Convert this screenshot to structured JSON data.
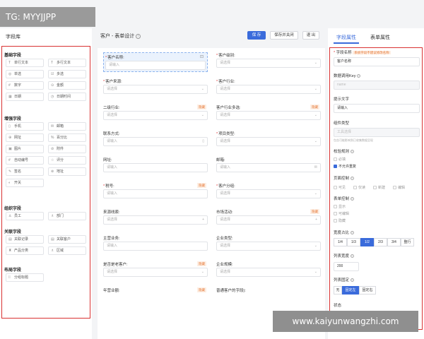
{
  "watermark": "TG: MYYJJPP",
  "url_watermark": "www.kaiyunwangzhi.com",
  "left": {
    "title": "字段库",
    "groups": [
      {
        "name": "基础字段",
        "fields": [
          {
            "icon": "T",
            "label": "单行文本"
          },
          {
            "icon": "T",
            "label": "多行文本"
          },
          {
            "icon": "◎",
            "label": "单选"
          },
          {
            "icon": "☑",
            "label": "多选"
          },
          {
            "icon": "#",
            "label": "数字"
          },
          {
            "icon": "⊙",
            "label": "金额"
          },
          {
            "icon": "▦",
            "label": "日期"
          },
          {
            "icon": "◷",
            "label": "日期时间"
          }
        ]
      },
      {
        "name": "增强字段",
        "fields": [
          {
            "icon": "▯",
            "label": "手机"
          },
          {
            "icon": "✉",
            "label": "邮箱"
          },
          {
            "icon": "⊕",
            "label": "网址"
          },
          {
            "icon": "%",
            "label": "百分比"
          },
          {
            "icon": "▣",
            "label": "图片"
          },
          {
            "icon": "⊘",
            "label": "附件"
          },
          {
            "icon": "#",
            "label": "自动编号"
          },
          {
            "icon": "☆",
            "label": "评分"
          },
          {
            "icon": "✎",
            "label": "签名"
          },
          {
            "icon": "⊚",
            "label": "地址"
          },
          {
            "icon": "◐",
            "label": "开关"
          }
        ]
      },
      {
        "name": "组织字段",
        "fields": [
          {
            "icon": "♙",
            "label": "员工"
          },
          {
            "icon": "♗",
            "label": "部门"
          }
        ]
      },
      {
        "name": "关联字段",
        "fields": [
          {
            "icon": "▤",
            "label": "关联记录"
          },
          {
            "icon": "▤",
            "label": "关联客户"
          },
          {
            "icon": "♜",
            "label": "产品分类"
          },
          {
            "icon": "♗",
            "label": "区域"
          }
        ]
      },
      {
        "name": "布局字段",
        "fields": [
          {
            "icon": "⁞⁞",
            "label": "分组标题"
          }
        ]
      }
    ]
  },
  "center": {
    "title": "客户 - 表单设计",
    "buttons": {
      "save": "保 存",
      "save_close": "保存并关闭",
      "exit": "退 出"
    },
    "items": [
      {
        "label": "客户名称:",
        "required": true,
        "placeholder": "请输入",
        "suffix": "",
        "tag": "",
        "lock": true,
        "selected": true
      },
      {
        "label": "客户级别:",
        "required": true,
        "placeholder": "请选择",
        "suffix": "⌄",
        "tag": "",
        "lock": false,
        "selected": false
      },
      {
        "label": "客户来源:",
        "required": true,
        "placeholder": "请选择",
        "suffix": "⌄",
        "tag": "",
        "lock": false,
        "selected": false
      },
      {
        "label": "客户行业:",
        "required": true,
        "placeholder": "请选择",
        "suffix": "⌄",
        "tag": "",
        "lock": false,
        "selected": false
      },
      {
        "label": "二级行业:",
        "required": false,
        "placeholder": "请选择",
        "suffix": "⌄",
        "tag": "隐藏",
        "lock": false,
        "selected": false
      },
      {
        "label": "客户行业多选:",
        "required": false,
        "placeholder": "请选择",
        "suffix": "⌄",
        "tag": "隐藏",
        "lock": false,
        "selected": false
      },
      {
        "label": "联系方式:",
        "required": false,
        "placeholder": "请输入",
        "suffix": "▯",
        "tag": "",
        "lock": false,
        "selected": false
      },
      {
        "label": "项目类型:",
        "required": true,
        "placeholder": "请选择",
        "suffix": "⌄",
        "tag": "",
        "lock": false,
        "selected": false
      },
      {
        "label": "网址:",
        "required": false,
        "placeholder": "请输入",
        "suffix": "",
        "tag": "",
        "lock": false,
        "selected": false
      },
      {
        "label": "邮箱:",
        "required": false,
        "placeholder": "请输入",
        "suffix": "✉",
        "tag": "",
        "lock": false,
        "selected": false
      },
      {
        "label": "税号:",
        "required": true,
        "placeholder": "请输入",
        "suffix": "",
        "tag": "隐藏",
        "lock": false,
        "selected": false
      },
      {
        "label": "客户分组:",
        "required": true,
        "placeholder": "请选择",
        "suffix": "⌄",
        "tag": "",
        "lock": false,
        "selected": false
      },
      {
        "label": "来源线索:",
        "required": false,
        "placeholder": "请选择",
        "suffix": "+",
        "tag": "",
        "lock": false,
        "selected": false
      },
      {
        "label": "市场活动:",
        "required": false,
        "placeholder": "请选择",
        "suffix": "+",
        "tag": "隐藏",
        "lock": false,
        "selected": false
      },
      {
        "label": "主营业务:",
        "required": false,
        "placeholder": "请输入",
        "suffix": "",
        "tag": "",
        "lock": false,
        "selected": false
      },
      {
        "label": "企业类型:",
        "required": false,
        "placeholder": "请选择",
        "suffix": "⌄",
        "tag": "",
        "lock": false,
        "selected": false
      },
      {
        "label": "是否是老客户:",
        "required": false,
        "placeholder": "请选择",
        "suffix": "⌄",
        "tag": "隐藏",
        "lock": false,
        "selected": false
      },
      {
        "label": "企业规模:",
        "required": false,
        "placeholder": "请选择",
        "suffix": "⌄",
        "tag": "",
        "lock": false,
        "selected": false
      },
      {
        "label": "年营业额:",
        "required": false,
        "placeholder": "",
        "suffix": "",
        "tag": "隐藏",
        "lock": false,
        "selected": false
      },
      {
        "label": "普通客户的字段):",
        "required": false,
        "placeholder": "",
        "suffix": "",
        "tag": "",
        "lock": false,
        "selected": false
      }
    ]
  },
  "right": {
    "tabs": [
      "字段属性",
      "表单属性"
    ],
    "field_name_label": "字段名称",
    "field_name_hint": "系统字段不建议修改名称",
    "field_name_value": "客户名称",
    "data_key_label": "数据调用Key",
    "data_key_value": "name",
    "hint_label": "提示文字",
    "hint_value": "请输入",
    "component_type_label": "组件类型",
    "component_type_value": "工具选择",
    "component_type_note": "包含可能影响到已收集数据呈现",
    "validation_label": "校验规则",
    "validation_options": [
      {
        "label": "必填",
        "checked": false,
        "dark": false
      },
      {
        "label": "不允许重复",
        "checked": true,
        "dark": true
      }
    ],
    "page_control_label": "页面控制",
    "page_control_options": [
      "可见",
      "仅读",
      "新建",
      "编辑"
    ],
    "form_control_label": "表单控制",
    "form_control_options": [
      "显示",
      "可编辑",
      "隐藏"
    ],
    "width_label": "宽度占比",
    "width_options": [
      {
        "label": "1/4",
        "on": false
      },
      {
        "label": "1/3",
        "on": false
      },
      {
        "label": "1/2",
        "on": true
      },
      {
        "label": "2/3",
        "on": false
      },
      {
        "label": "3/4",
        "on": false
      },
      {
        "label": "整行",
        "on": false
      }
    ],
    "list_width_label": "列表宽度",
    "list_width_value": "200",
    "list_fixed_label": "列表固定",
    "list_fixed_options": [
      {
        "label": "无",
        "on": false
      },
      {
        "label": "固定左",
        "on": true
      },
      {
        "label": "固定右",
        "on": false
      }
    ],
    "status_label": "状态"
  }
}
